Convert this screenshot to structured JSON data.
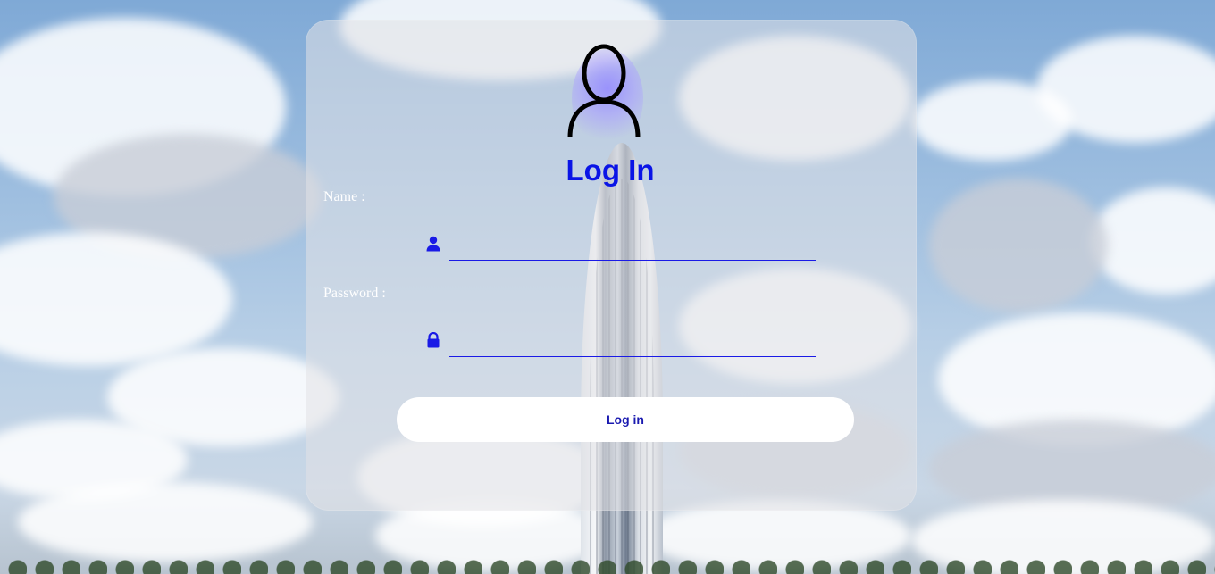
{
  "login": {
    "title": "Log In",
    "name_label": "Name :",
    "password_label": "Password :",
    "name_value": "",
    "password_value": "",
    "button_label": "Log in"
  },
  "icons": {
    "avatar": "user-outline-icon",
    "name_field": "user-icon",
    "password_field": "lock-icon"
  },
  "colors": {
    "accent": "#0a14e6",
    "button_text": "#1a1ab0",
    "field_underline": "#1a1ae6",
    "label": "#ffffff"
  }
}
